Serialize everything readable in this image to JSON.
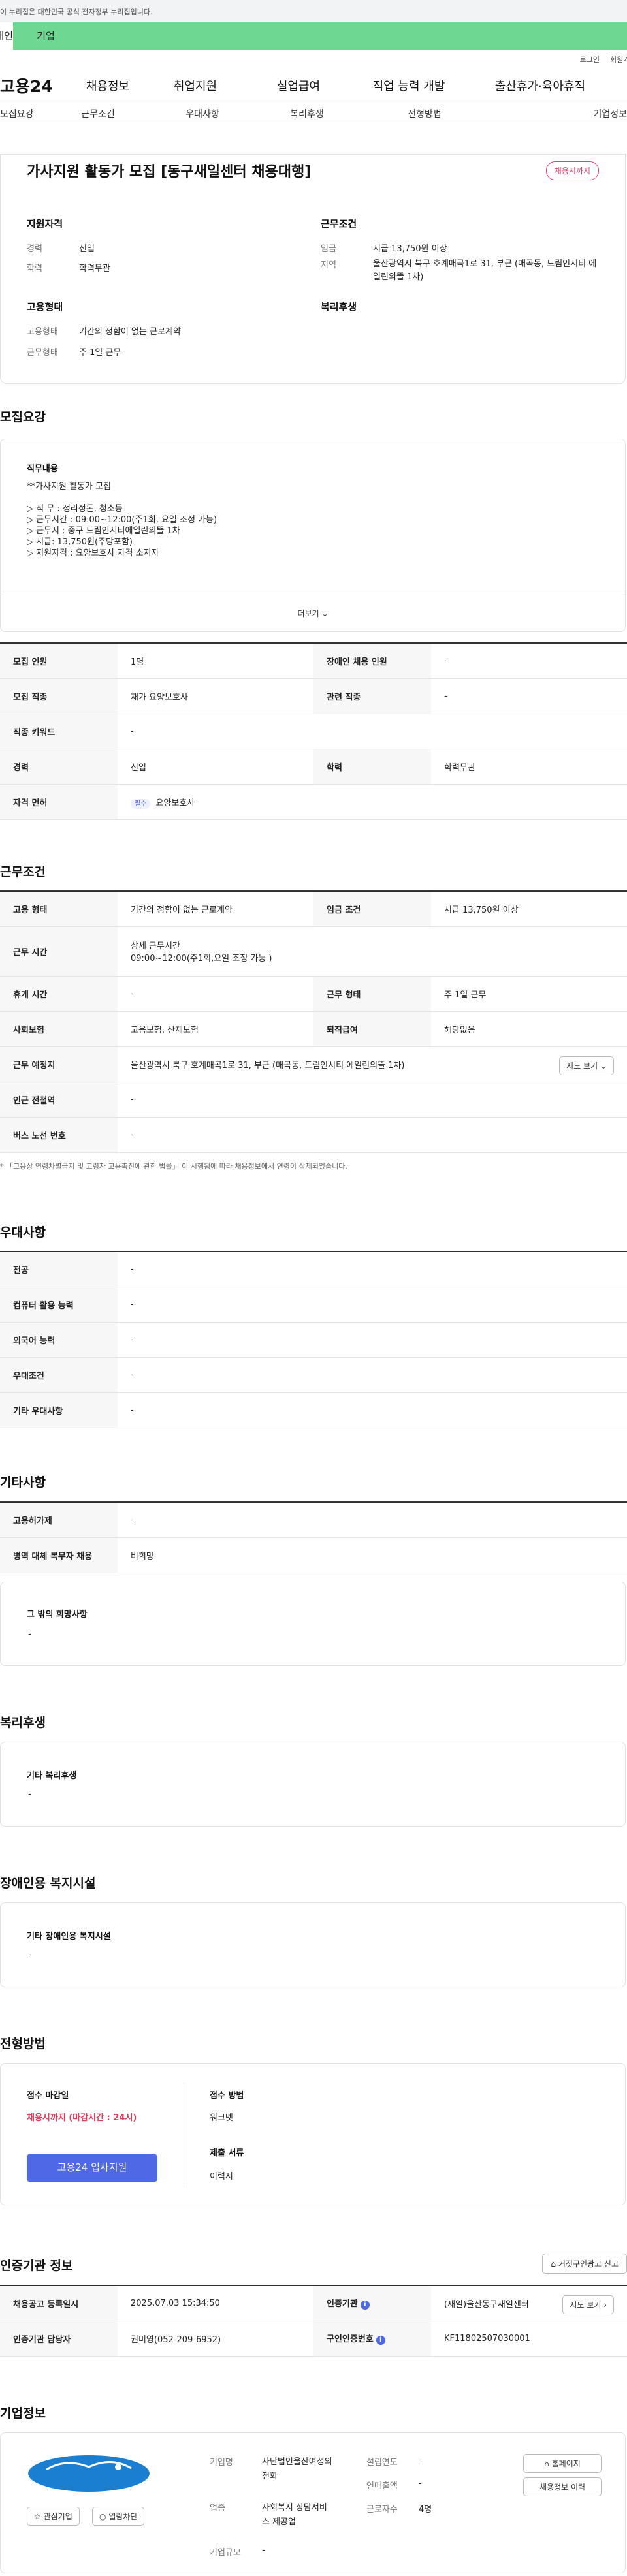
{
  "top": {
    "notice": "이 누리집은 대한민국 공식 전자정부 누리집입니다.",
    "tab_personal": "개인",
    "tab_company": "기업"
  },
  "util": {
    "login": "로그인",
    "join": "회원가입"
  },
  "gnb": {
    "logo": "고용24",
    "menu": [
      "채용정보",
      "취업지원",
      "실업급여",
      "직업 능력 개발",
      "출산휴가·육아휴직"
    ]
  },
  "subnav": [
    "모집요강",
    "근무조건",
    "우대사항",
    "복리후생",
    "전형방법",
    "기업정보"
  ],
  "header": {
    "title": "가사지원 활동가 모집 [동구새일센터 채용대행]",
    "status": "채용시까지",
    "qual_title": "지원자격",
    "career_k": "경력",
    "career_v": "신입",
    "edu_k": "학력",
    "edu_v": "학력무관",
    "work_title": "근무조건",
    "wage_k": "임금",
    "wage_v": "시급 13,750원 이상",
    "area_k": "지역",
    "area_v": "울산광역시 북구 호계매곡1로 31, 부근 (매곡동, 드림인시티 에일린의뜰 1차)",
    "emp_title": "고용형태",
    "emp_k": "고용형태",
    "emp_v": "기간의 정함이 없는 근로계약",
    "type_k": "근무형태",
    "type_v": "주 1일 근무",
    "benefit_title": "복리후생"
  },
  "recruit": {
    "title": "모집요강",
    "job_title": "직무내용",
    "job_lines": [
      "**가사지원 활동가 모집",
      "",
      "▷ 직   무 : 정리정돈, 청소등",
      "▷ 근무시간 : 09:00~12:00(주1회, 요일 조정 가능)",
      "▷ 근무지 : 중구 드림인시티에일린의뜰 1차",
      "▷ 시급: 13,750원(주당포함)",
      "▷ 지원자격 : 요양보호사 자격 소지자"
    ],
    "more": "더보기",
    "rows": [
      {
        "k1": "모집 인원",
        "v1": "1명",
        "k2": "장애인 채용 인원",
        "v2": "-"
      },
      {
        "k1": "모집 직종",
        "v1": "재가 요양보호사",
        "k2": "관련 직종",
        "v2": "-"
      },
      {
        "k1": "직종 키워드",
        "v1": "-"
      },
      {
        "k1": "경력",
        "v1": "신입",
        "k2": "학력",
        "v2": "학력무관"
      },
      {
        "k1": "자격 면허",
        "badge": "필수",
        "v1": "요양보호사"
      }
    ]
  },
  "work": {
    "title": "근무조건",
    "emp_k": "고용 형태",
    "emp_v": "기간의 정함이 없는 근로계약",
    "wage_k": "임금 조건",
    "wage_v": "시급 13,750원 이상",
    "time_k": "근무 시간",
    "time_v1": "상세 근무시간",
    "time_v2": "09:00~12:00(주1회,요일 조정 가능 )",
    "rest_k": "휴게 시간",
    "rest_v": "-",
    "type_k": "근무 형태",
    "type_v": "주 1일 근무",
    "ins_k": "사회보험",
    "ins_v": "고용보험, 산재보험",
    "ret_k": "퇴직급여",
    "ret_v": "해당없음",
    "place_k": "근무 예정지",
    "place_v": "울산광역시 북구 호계매곡1로 31, 부근 (매곡동, 드림인시티 에일린의뜰 1차)",
    "map_btn": "지도 보기",
    "sub_k": "인근 전철역",
    "sub_v": "-",
    "bus_k": "버스 노선 번호",
    "bus_v": "-",
    "note": "* 「고용상 연령차별금지 및 고령자 고용촉진에 관한 법률」 이 시행됨에 따라 채용정보에서 연령이 삭제되었습니다."
  },
  "pref": {
    "title": "우대사항",
    "rows": [
      {
        "k": "전공",
        "v": "-"
      },
      {
        "k": "컴퓨터 활용 능력",
        "v": "-"
      },
      {
        "k": "외국어 능력",
        "v": "-"
      },
      {
        "k": "우대조건",
        "v": "-"
      },
      {
        "k": "기타 우대사항",
        "v": "-"
      }
    ]
  },
  "etc": {
    "title": "기타사항",
    "rows": [
      {
        "k": "고용허가제",
        "v": "-"
      },
      {
        "k": "병역 대체 복무자 채용",
        "v": "비희망"
      }
    ],
    "other_title": "그 밖의 희망사항",
    "other_v": "-"
  },
  "welfare": {
    "title": "복리후생",
    "sub": "기타 복리후생",
    "v": "-"
  },
  "disab": {
    "title": "장애인용 복지시설",
    "sub": "기타 장애인용 복지시설",
    "v": "-"
  },
  "process": {
    "title": "전형방법",
    "deadline_k": "접수 마감일",
    "deadline_v": "채용시까지 (마감시간 : 24시)",
    "apply": "고용24 입사지원",
    "method_k": "접수 방법",
    "method_v": "워크넷",
    "docs_k": "제출 서류",
    "docs_v": "이력서"
  },
  "cert": {
    "title": "인증기관 정보",
    "report_btn": "거짓구인광고 신고",
    "reg_k": "채용공고 등록일시",
    "reg_v": "2025.07.03 15:34:50",
    "org_k": "인증기관",
    "org_v": "(새일)울산동구새일센터",
    "map_btn": "지도 보기",
    "mgr_k": "인증기관 담당자",
    "mgr_v": "권미영(052-209-6952)",
    "no_k": "구인인증번호",
    "no_v": "KF11802507030001"
  },
  "company": {
    "title": "기업정보",
    "fav": "관심기업",
    "block": "열람차단",
    "name_k": "기업명",
    "name_v": "사단법인울산여성의전화",
    "biz_k": "업종",
    "biz_v": "사회복지 상담서비스 제공업",
    "size_k": "기업규모",
    "size_v": "-",
    "year_k": "설립연도",
    "year_v": "-",
    "sales_k": "연매출액",
    "sales_v": "-",
    "emp_k": "근로자수",
    "emp_v": "4명",
    "home_btn": "홈페이지",
    "hist_btn": "채용정보 이력"
  }
}
